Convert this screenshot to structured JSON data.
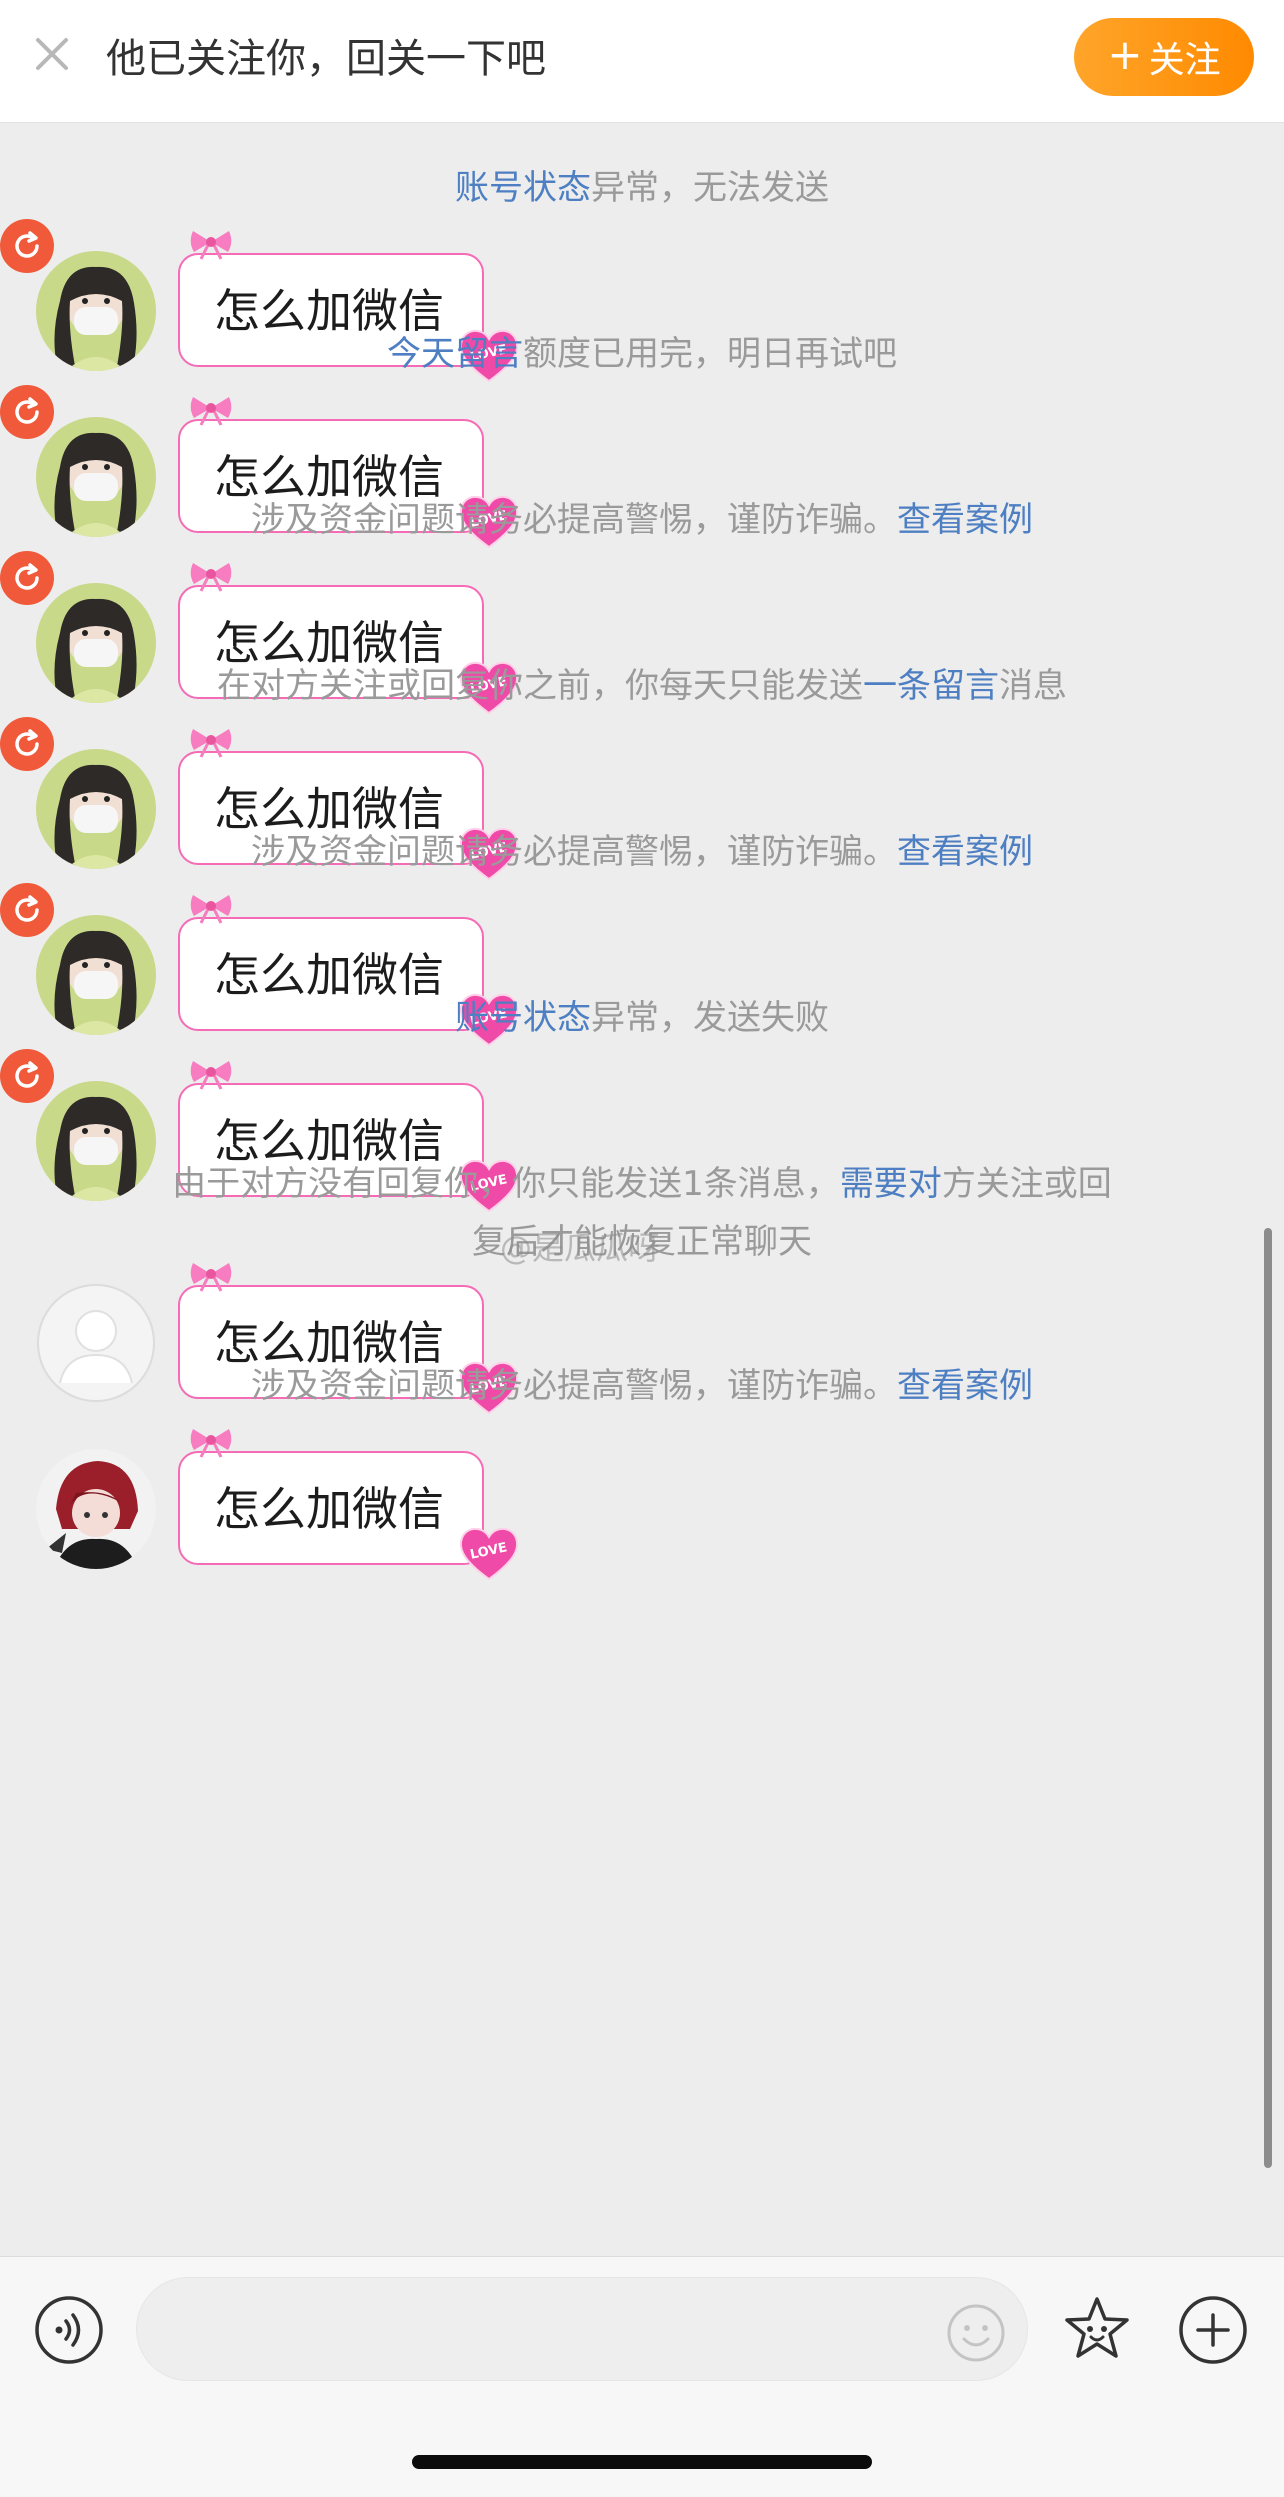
{
  "banner": {
    "tip": "他已关注你，回关一下吧",
    "follow_label": "关注",
    "follow_plus": "+",
    "preview_text": "怎么加微信"
  },
  "notices": [
    {
      "link": "账号状态",
      "rest": "异常，无法发送"
    },
    {
      "link": "今天留言",
      "rest": "额度已用完，明日再试吧"
    },
    {
      "pre": "涉及资金问题请务必提高警惕，谨防诈骗。",
      "link": "查看案例"
    },
    {
      "pre": "在对方关注或回复你之前，你每天只能发送",
      "link": "一条留言",
      "rest": "消息"
    },
    {
      "pre": "涉及资金问题请务必提高警惕，谨防诈骗。",
      "link": "查看案例"
    },
    {
      "link": "账号状态",
      "rest": "异常，发送失败"
    },
    {
      "pre": "由于对方没有回复你，你只能发送1条消息，",
      "link": "需要对",
      "rest": "方关注或回",
      "line2": "复后才能恢复正常聊天"
    },
    {
      "pre": "涉及资金问题请务必提高警惕，谨防诈骗。",
      "link": "查看案例"
    }
  ],
  "messages": [
    {
      "text": "怎么加微信",
      "failed": true,
      "avatar": "masked-woman"
    },
    {
      "text": "怎么加微信",
      "failed": true,
      "avatar": "masked-woman"
    },
    {
      "text": "怎么加微信",
      "failed": true,
      "avatar": "masked-woman"
    },
    {
      "text": "怎么加微信",
      "failed": true,
      "avatar": "masked-woman"
    },
    {
      "text": "怎么加微信",
      "failed": true,
      "avatar": "masked-woman"
    },
    {
      "text": "怎么加微信",
      "failed": true,
      "avatar": "masked-woman"
    },
    {
      "text": "怎么加微信",
      "failed": false,
      "avatar": "default-silhouette"
    },
    {
      "text": "怎么加微信",
      "failed": false,
      "avatar": "anime-red-hair"
    }
  ],
  "watermark": "@是瓜瓜呀",
  "input": {
    "placeholder": ""
  },
  "colors": {
    "accent": "#ff8a00",
    "link": "#4d7fc2",
    "notice_text": "#9a9a9a",
    "bubble_border": "#f56bb5",
    "retry_badge": "#f05a3a"
  },
  "icons": {
    "close": "close-icon",
    "retry": "retry-icon",
    "voice": "voice-icon",
    "emoji": "emoji-icon",
    "sticker": "sticker-icon",
    "plus": "plus-icon",
    "bow": "bow-icon",
    "heart": "love-heart-icon"
  }
}
